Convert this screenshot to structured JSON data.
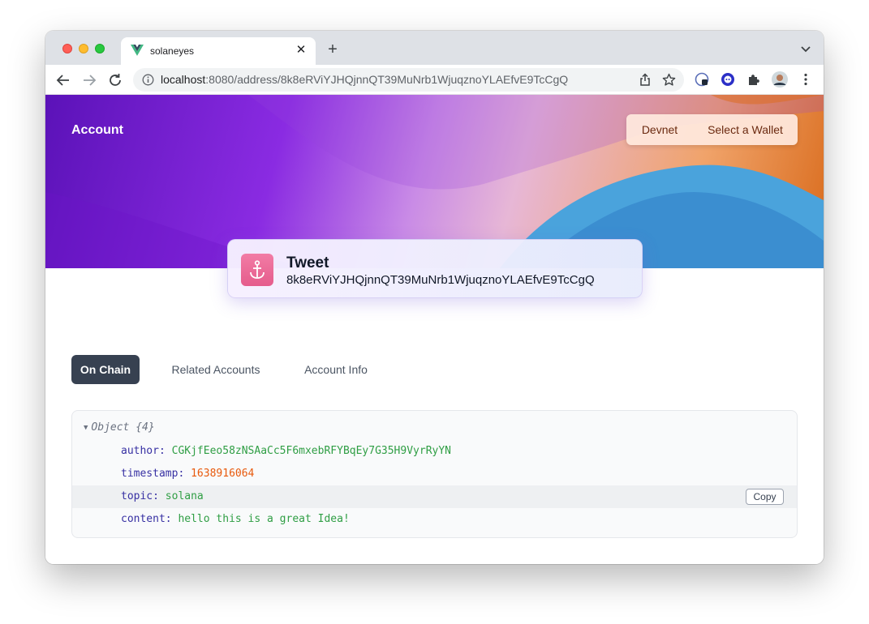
{
  "browser": {
    "tab_title": "solaneyes",
    "new_tab_symbol": "+",
    "url_host": "localhost",
    "url_path": ":8080/address/8k8eRViYJHQjnnQT39MuNrb1WjuqznoYLAEfvE9TcCgQ",
    "icons": {
      "back": "back-arrow-icon",
      "forward": "forward-arrow-icon",
      "reload": "reload-icon",
      "info": "info-icon",
      "share": "share-icon",
      "star": "bookmark-star-icon",
      "extensions": "puzzle-icon",
      "menu": "kebab-menu-icon"
    }
  },
  "hero": {
    "title": "Account"
  },
  "wallet": {
    "network_label": "Devnet",
    "select_label": "Select a Wallet"
  },
  "account": {
    "type": "Tweet",
    "address": "8k8eRViYJHQjnnQT39MuNrb1WjuqznoYLAEfvE9TcCgQ",
    "icon": "anchor-icon"
  },
  "tabs": [
    {
      "label": "On Chain",
      "active": true
    },
    {
      "label": "Related Accounts",
      "active": false
    },
    {
      "label": "Account Info",
      "active": false
    }
  ],
  "json_view": {
    "header": "Object {4}",
    "fields": [
      {
        "key": "author:",
        "value": "CGKjfEeo58zNSAaCc5F6mxebRFYBqEy7G35H9VyrRyYN",
        "kind": "string"
      },
      {
        "key": "timestamp:",
        "value": "1638916064",
        "kind": "number"
      },
      {
        "key": "topic:",
        "value": "solana",
        "kind": "string"
      },
      {
        "key": "content:",
        "value": "hello this is a great Idea!",
        "kind": "string"
      }
    ],
    "copy_label": "Copy"
  },
  "colors": {
    "active_tab_bg": "#374151",
    "json_key": "#3730a3",
    "json_string": "#2f9e44",
    "json_number": "#e8590c",
    "wallet_text": "#6b2a10"
  }
}
